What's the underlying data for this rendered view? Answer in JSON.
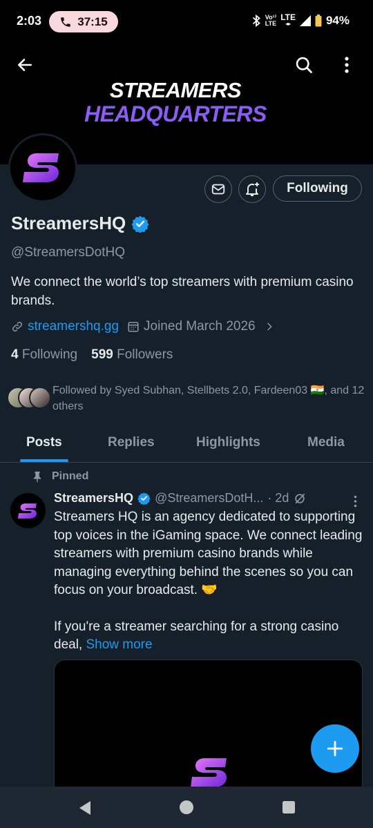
{
  "status_bar": {
    "time": "2:03",
    "call_duration": "37:15",
    "network_top": "Vo¹⁾",
    "network_bottom": "LTE",
    "lte_label": "LTE",
    "battery": "94%"
  },
  "banner": {
    "line1": "STREAMERS",
    "line2": "HEADQUARTERS"
  },
  "profile": {
    "display_name": "StreamersHQ",
    "handle": "@StreamersDotHQ",
    "bio": "We connect the world’s top streamers with premium casino brands.",
    "website": "streamershq.gg",
    "joined": "Joined March 2026",
    "following_count": "4",
    "following_label": "Following",
    "followers_count": "599",
    "followers_label": "Followers",
    "followed_by": "Followed by Syed Subhan, Stellbets 2.0, Fardeen03 🇮🇳, and 12 others",
    "follow_button": "Following"
  },
  "tabs": [
    {
      "label": "Posts",
      "active": true
    },
    {
      "label": "Replies",
      "active": false
    },
    {
      "label": "Highlights",
      "active": false
    },
    {
      "label": "Media",
      "active": false
    }
  ],
  "post": {
    "pinned_label": "Pinned",
    "author_name": "StreamersHQ",
    "author_handle": "@StreamersDotH...",
    "time": "· 2d",
    "paragraph1": "Streamers HQ is an agency dedicated to supporting top voices in the iGaming space. We connect leading streamers with premium casino brands while managing everything behind the scenes so you can focus on your broadcast. 🤝",
    "paragraph2": "If you're a streamer searching for a strong casino deal,",
    "show_more": "Show more"
  },
  "colors": {
    "accent": "#1d9bf0",
    "background": "#15202b",
    "brand_purple": "#8b5cf6"
  },
  "icons": [
    "back-arrow-icon",
    "search-icon",
    "more-vertical-icon",
    "mail-icon",
    "bell-plus-icon",
    "verified-icon",
    "link-icon",
    "calendar-icon",
    "chevron-right-icon",
    "pin-icon",
    "grok-icon",
    "plus-icon"
  ]
}
